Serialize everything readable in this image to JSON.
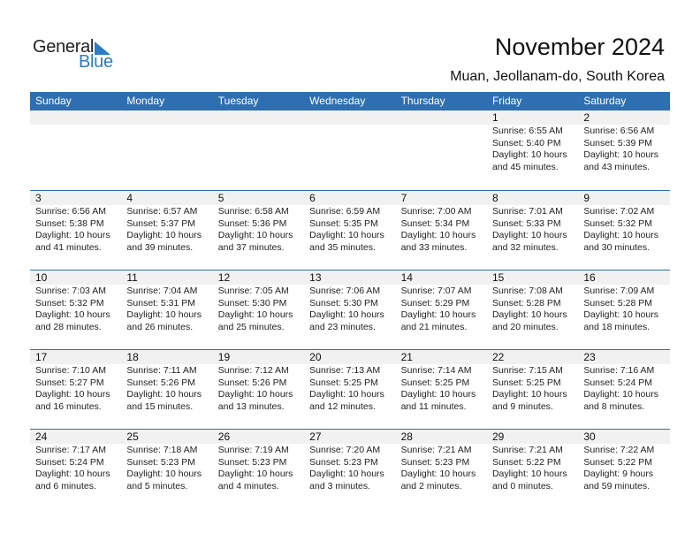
{
  "logo": {
    "word1": "General",
    "word2": "Blue"
  },
  "header": {
    "title": "November 2024",
    "location": "Muan, Jeollanam-do, South Korea"
  },
  "colors": {
    "accent": "#2e6fb2",
    "logo_blue": "#2e7bc4",
    "day_number_bg": "#f1f1f1"
  },
  "weekdays": [
    "Sunday",
    "Monday",
    "Tuesday",
    "Wednesday",
    "Thursday",
    "Friday",
    "Saturday"
  ],
  "weeks": [
    [
      {
        "day": "",
        "sunrise": "",
        "sunset": "",
        "daylight": ""
      },
      {
        "day": "",
        "sunrise": "",
        "sunset": "",
        "daylight": ""
      },
      {
        "day": "",
        "sunrise": "",
        "sunset": "",
        "daylight": ""
      },
      {
        "day": "",
        "sunrise": "",
        "sunset": "",
        "daylight": ""
      },
      {
        "day": "",
        "sunrise": "",
        "sunset": "",
        "daylight": ""
      },
      {
        "day": "1",
        "sunrise": "Sunrise: 6:55 AM",
        "sunset": "Sunset: 5:40 PM",
        "daylight": "Daylight: 10 hours\nand 45 minutes."
      },
      {
        "day": "2",
        "sunrise": "Sunrise: 6:56 AM",
        "sunset": "Sunset: 5:39 PM",
        "daylight": "Daylight: 10 hours\nand 43 minutes."
      }
    ],
    [
      {
        "day": "3",
        "sunrise": "Sunrise: 6:56 AM",
        "sunset": "Sunset: 5:38 PM",
        "daylight": "Daylight: 10 hours\nand 41 minutes."
      },
      {
        "day": "4",
        "sunrise": "Sunrise: 6:57 AM",
        "sunset": "Sunset: 5:37 PM",
        "daylight": "Daylight: 10 hours\nand 39 minutes."
      },
      {
        "day": "5",
        "sunrise": "Sunrise: 6:58 AM",
        "sunset": "Sunset: 5:36 PM",
        "daylight": "Daylight: 10 hours\nand 37 minutes."
      },
      {
        "day": "6",
        "sunrise": "Sunrise: 6:59 AM",
        "sunset": "Sunset: 5:35 PM",
        "daylight": "Daylight: 10 hours\nand 35 minutes."
      },
      {
        "day": "7",
        "sunrise": "Sunrise: 7:00 AM",
        "sunset": "Sunset: 5:34 PM",
        "daylight": "Daylight: 10 hours\nand 33 minutes."
      },
      {
        "day": "8",
        "sunrise": "Sunrise: 7:01 AM",
        "sunset": "Sunset: 5:33 PM",
        "daylight": "Daylight: 10 hours\nand 32 minutes."
      },
      {
        "day": "9",
        "sunrise": "Sunrise: 7:02 AM",
        "sunset": "Sunset: 5:32 PM",
        "daylight": "Daylight: 10 hours\nand 30 minutes."
      }
    ],
    [
      {
        "day": "10",
        "sunrise": "Sunrise: 7:03 AM",
        "sunset": "Sunset: 5:32 PM",
        "daylight": "Daylight: 10 hours\nand 28 minutes."
      },
      {
        "day": "11",
        "sunrise": "Sunrise: 7:04 AM",
        "sunset": "Sunset: 5:31 PM",
        "daylight": "Daylight: 10 hours\nand 26 minutes."
      },
      {
        "day": "12",
        "sunrise": "Sunrise: 7:05 AM",
        "sunset": "Sunset: 5:30 PM",
        "daylight": "Daylight: 10 hours\nand 25 minutes."
      },
      {
        "day": "13",
        "sunrise": "Sunrise: 7:06 AM",
        "sunset": "Sunset: 5:30 PM",
        "daylight": "Daylight: 10 hours\nand 23 minutes."
      },
      {
        "day": "14",
        "sunrise": "Sunrise: 7:07 AM",
        "sunset": "Sunset: 5:29 PM",
        "daylight": "Daylight: 10 hours\nand 21 minutes."
      },
      {
        "day": "15",
        "sunrise": "Sunrise: 7:08 AM",
        "sunset": "Sunset: 5:28 PM",
        "daylight": "Daylight: 10 hours\nand 20 minutes."
      },
      {
        "day": "16",
        "sunrise": "Sunrise: 7:09 AM",
        "sunset": "Sunset: 5:28 PM",
        "daylight": "Daylight: 10 hours\nand 18 minutes."
      }
    ],
    [
      {
        "day": "17",
        "sunrise": "Sunrise: 7:10 AM",
        "sunset": "Sunset: 5:27 PM",
        "daylight": "Daylight: 10 hours\nand 16 minutes."
      },
      {
        "day": "18",
        "sunrise": "Sunrise: 7:11 AM",
        "sunset": "Sunset: 5:26 PM",
        "daylight": "Daylight: 10 hours\nand 15 minutes."
      },
      {
        "day": "19",
        "sunrise": "Sunrise: 7:12 AM",
        "sunset": "Sunset: 5:26 PM",
        "daylight": "Daylight: 10 hours\nand 13 minutes."
      },
      {
        "day": "20",
        "sunrise": "Sunrise: 7:13 AM",
        "sunset": "Sunset: 5:25 PM",
        "daylight": "Daylight: 10 hours\nand 12 minutes."
      },
      {
        "day": "21",
        "sunrise": "Sunrise: 7:14 AM",
        "sunset": "Sunset: 5:25 PM",
        "daylight": "Daylight: 10 hours\nand 11 minutes."
      },
      {
        "day": "22",
        "sunrise": "Sunrise: 7:15 AM",
        "sunset": "Sunset: 5:25 PM",
        "daylight": "Daylight: 10 hours\nand 9 minutes."
      },
      {
        "day": "23",
        "sunrise": "Sunrise: 7:16 AM",
        "sunset": "Sunset: 5:24 PM",
        "daylight": "Daylight: 10 hours\nand 8 minutes."
      }
    ],
    [
      {
        "day": "24",
        "sunrise": "Sunrise: 7:17 AM",
        "sunset": "Sunset: 5:24 PM",
        "daylight": "Daylight: 10 hours\nand 6 minutes."
      },
      {
        "day": "25",
        "sunrise": "Sunrise: 7:18 AM",
        "sunset": "Sunset: 5:23 PM",
        "daylight": "Daylight: 10 hours\nand 5 minutes."
      },
      {
        "day": "26",
        "sunrise": "Sunrise: 7:19 AM",
        "sunset": "Sunset: 5:23 PM",
        "daylight": "Daylight: 10 hours\nand 4 minutes."
      },
      {
        "day": "27",
        "sunrise": "Sunrise: 7:20 AM",
        "sunset": "Sunset: 5:23 PM",
        "daylight": "Daylight: 10 hours\nand 3 minutes."
      },
      {
        "day": "28",
        "sunrise": "Sunrise: 7:21 AM",
        "sunset": "Sunset: 5:23 PM",
        "daylight": "Daylight: 10 hours\nand 2 minutes."
      },
      {
        "day": "29",
        "sunrise": "Sunrise: 7:21 AM",
        "sunset": "Sunset: 5:22 PM",
        "daylight": "Daylight: 10 hours\nand 0 minutes."
      },
      {
        "day": "30",
        "sunrise": "Sunrise: 7:22 AM",
        "sunset": "Sunset: 5:22 PM",
        "daylight": "Daylight: 9 hours\nand 59 minutes."
      }
    ]
  ]
}
